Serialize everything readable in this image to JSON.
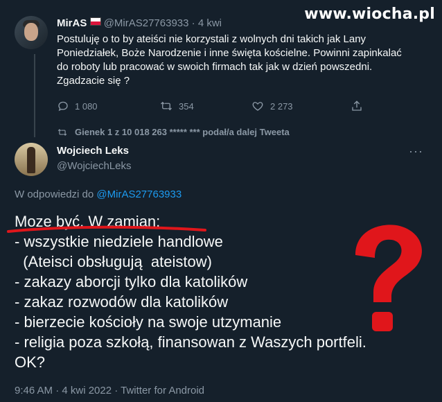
{
  "watermark": "www.wiocha.pl",
  "tweet1": {
    "name": "MirAS",
    "handle": "@MirAS27763933",
    "time": "· 4 kwi",
    "text_lines": [
      "Postuluję o to by ateiści nie korzystali z wolnych dni takich jak Lany",
      "Poniedziałek,  Boże Narodzenie i inne święta kościelne. Powinni zapinkalać",
      "do roboty lub pracować w swoich firmach tak jak w dzień powszedni.",
      "Zgadzacie się ?"
    ],
    "replies": "1 080",
    "retweets": "354",
    "likes": "2 273"
  },
  "retweet_note": "Gienek 1 z 10 018 263 ***** *** podał/a dalej Tweeta",
  "tweet2": {
    "name": "Wojciech Leks",
    "handle": "@WojciechLeks",
    "reply_to_label": "W odpowiedzi do",
    "reply_to_handle": "@MirAS27763933",
    "text_lines": [
      "Moze być.  W zamian:",
      "- wszystkie niedziele handlowe",
      "  (Ateisci obsługują  ateistow)",
      "- zakazy aborcji tylko dla katolików",
      "- zakaz rozwodów dla katolików",
      "- bierzecie kościoły na swoje utzymanie",
      "- religia poza szkołą, finansowan z Waszych portfeli.",
      "OK?"
    ],
    "footer": "9:46 AM · 4 kwi 2022 · Twitter for Android"
  },
  "colors": {
    "background": "#15202b",
    "link": "#1d9bf0",
    "muted": "#8b98a5",
    "annotation_red": "#e0161b"
  }
}
